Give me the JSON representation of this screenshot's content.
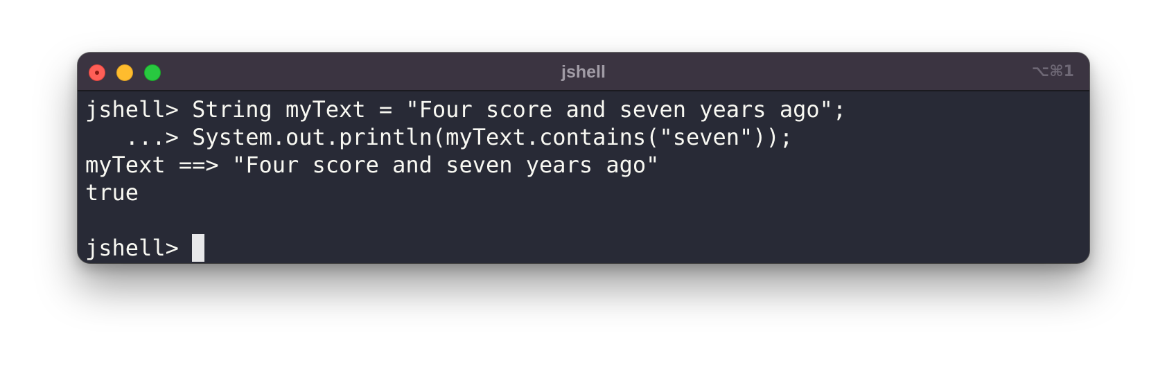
{
  "window": {
    "title": "jshell",
    "shortcut": "⌥⌘1"
  },
  "terminal": {
    "lines": [
      "jshell> String myText = \"Four score and seven years ago\";",
      "   ...> System.out.println(myText.contains(\"seven\"));",
      "myText ==> \"Four score and seven years ago\"",
      "true",
      "",
      "jshell> "
    ]
  },
  "colors": {
    "background": "#282a36",
    "titlebar": "#3b3441",
    "text": "#f8f8f2",
    "cursor": "#e8e8ea",
    "close": "#ff5f57",
    "minimize": "#febc2e",
    "maximize": "#28c840"
  }
}
